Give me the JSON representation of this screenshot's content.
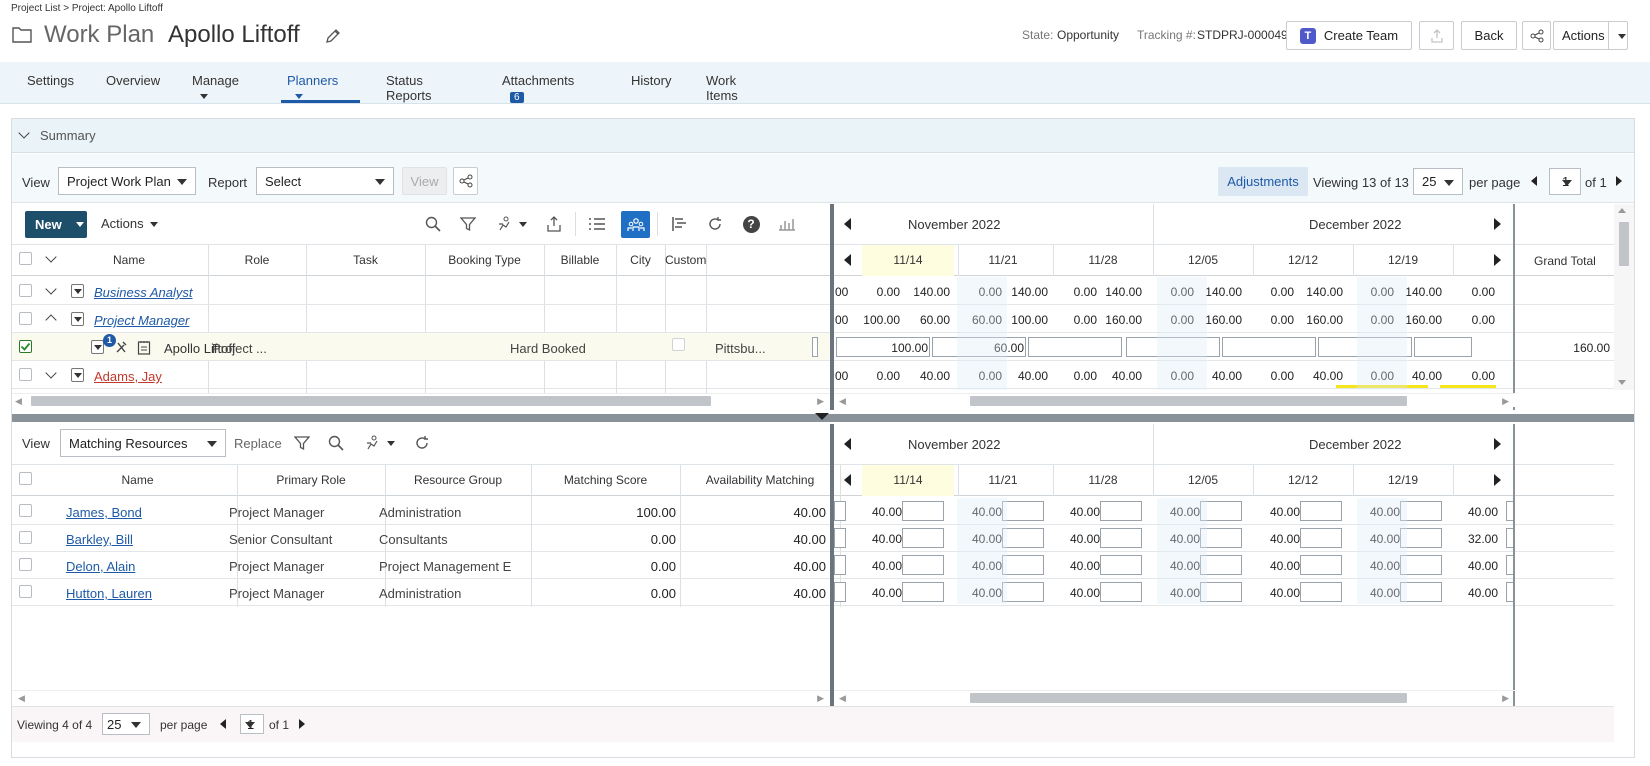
{
  "breadcrumb": "Project List > Project: Apollo Liftoff",
  "header": {
    "title_prefix": "Work Plan",
    "title": "Apollo Liftoff",
    "state_label": "State:",
    "state_value": "Opportunity",
    "tracking_label": "Tracking #:",
    "tracking_value": "STDPRJ-000049",
    "create_team": "Create Team",
    "back": "Back",
    "actions": "Actions"
  },
  "tabs": [
    {
      "label": "Settings"
    },
    {
      "label": "Overview"
    },
    {
      "label": "Manage"
    },
    {
      "label": "Planners"
    },
    {
      "label": "Status Reports"
    },
    {
      "label": "Attachments",
      "badge": "6"
    },
    {
      "label": "History"
    },
    {
      "label": "Work Items"
    }
  ],
  "summary": {
    "label": "Summary"
  },
  "top_toolbar": {
    "view_label": "View",
    "view_value": "Project Work Plan",
    "report_label": "Report",
    "report_value": "Select",
    "view_btn": "View",
    "adjustments": "Adjustments",
    "viewing_prefix": "Viewing",
    "viewing_count": "13 of 13",
    "per_page_value": "25",
    "per_page": "per page",
    "page": "1",
    "of": "of 1"
  },
  "grid_toolbar": {
    "new": "New",
    "actions": "Actions"
  },
  "top_grid": {
    "columns": [
      "Name",
      "Role",
      "Task",
      "Booking Type",
      "Billable",
      "City",
      "Custom"
    ],
    "months": [
      "November 2022",
      "December 2022"
    ],
    "weeks": [
      "11/14",
      "11/21",
      "11/28",
      "12/05",
      "12/12",
      "12/19"
    ],
    "grand_total": "Grand Total",
    "rows": [
      {
        "name": "Business Analyst",
        "lead": "00",
        "cells": [
          "0.00",
          "140.00",
          "0.00",
          "140.00",
          "0.00",
          "140.00",
          "0.00",
          "140.00",
          "0.00",
          "140.00",
          "0.00",
          "140.00",
          "0.00"
        ],
        "total": ""
      },
      {
        "name": "Project Manager",
        "lead": "00",
        "cells": [
          "100.00",
          "60.00",
          "60.00",
          "100.00",
          "0.00",
          "160.00",
          "0.00",
          "160.00",
          "0.00",
          "160.00",
          "0.00",
          "160.00",
          "0.00"
        ],
        "total": ""
      },
      {
        "name": "Apollo Liftoff",
        "role": "Project ...",
        "booking": "Hard Booked",
        "city": "Pittsbu...",
        "badge": "1",
        "inputs": [
          "100.00",
          "60.00",
          "",
          "",
          "",
          "",
          ""
        ],
        "total": "160.00"
      },
      {
        "name": "Adams, Jay",
        "lead": "00",
        "cells": [
          "0.00",
          "40.00",
          "0.00",
          "40.00",
          "0.00",
          "40.00",
          "0.00",
          "40.00",
          "0.00",
          "40.00",
          "0.00",
          "40.00",
          "0.00"
        ],
        "total": ""
      }
    ]
  },
  "bottom_toolbar": {
    "view_label": "View",
    "view_value": "Matching Resources",
    "replace": "Replace"
  },
  "bottom_grid": {
    "columns": [
      "Name",
      "Primary Role",
      "Resource Group",
      "Matching Score",
      "Availability Matching"
    ],
    "months": [
      "November 2022",
      "December 2022"
    ],
    "weeks": [
      "11/14",
      "11/21",
      "11/28",
      "12/05",
      "12/12",
      "12/19"
    ],
    "rows": [
      {
        "name": "James, Bond",
        "role": "Project Manager",
        "group": "Administration",
        "score": "100.00",
        "avail": "40.00",
        "weeks": [
          "40.00",
          "40.00",
          "40.00",
          "40.00",
          "40.00",
          "40.00",
          "40.00"
        ]
      },
      {
        "name": "Barkley, Bill",
        "role": "Senior Consultant",
        "group": "Consultants",
        "score": "0.00",
        "avail": "40.00",
        "weeks": [
          "40.00",
          "40.00",
          "40.00",
          "40.00",
          "40.00",
          "40.00",
          "32.00"
        ]
      },
      {
        "name": "Delon, Alain",
        "role": "Project Manager",
        "group": "Project Management E",
        "score": "0.00",
        "avail": "40.00",
        "weeks": [
          "40.00",
          "40.00",
          "40.00",
          "40.00",
          "40.00",
          "40.00",
          "40.00"
        ]
      },
      {
        "name": "Hutton, Lauren",
        "role": "Project Manager",
        "group": "Administration",
        "score": "0.00",
        "avail": "40.00",
        "weeks": [
          "40.00",
          "40.00",
          "40.00",
          "40.00",
          "40.00",
          "40.00",
          "40.00"
        ]
      }
    ]
  },
  "footer": {
    "viewing_prefix": "Viewing",
    "viewing_count": "4 of 4",
    "per_page_value": "25",
    "per_page": "per page",
    "page": "1",
    "of": "of 1"
  },
  "colors": {
    "accent": "#1f5aa6",
    "nav_bg": "#eef5fa",
    "today_col": "#fffde0",
    "dark_btn": "#1d4e6a"
  }
}
